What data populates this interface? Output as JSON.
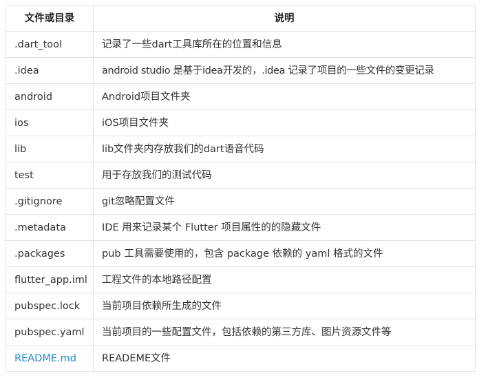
{
  "table": {
    "headers": [
      "文件或目录",
      "说明"
    ],
    "rows": [
      {
        "name": ".dart_tool",
        "desc": "记录了一些dart工具库所在的位置和信息"
      },
      {
        "name": ".idea",
        "desc": "android studio 是基于idea开发的，.idea 记录了项目的一些文件的变更记录"
      },
      {
        "name": "android",
        "desc": "Android项目文件夹"
      },
      {
        "name": "ios",
        "desc": "iOS项目文件夹"
      },
      {
        "name": "lib",
        "desc": "lib文件夹内存放我们的dart语音代码"
      },
      {
        "name": "test",
        "desc": "用于存放我们的测试代码"
      },
      {
        "name": ".gitignore",
        "desc": "git忽略配置文件"
      },
      {
        "name": ".metadata",
        "desc": "IDE 用来记录某个 Flutter 项目属性的的隐藏文件"
      },
      {
        "name": ".packages",
        "desc": "pub 工具需要使用的，包含 package 依赖的 yaml 格式的文件"
      },
      {
        "name": "flutter_app.iml",
        "desc": "工程文件的本地路径配置"
      },
      {
        "name": "pubspec.lock",
        "desc": "当前项目依赖所生成的文件"
      },
      {
        "name": "pubspec.yaml",
        "desc": "当前项目的一些配置文件，包括依赖的第三方库、图片资源文件等"
      },
      {
        "name": "README.md",
        "desc": "READEME文件"
      }
    ]
  },
  "colors": {
    "link": "#1e88c8",
    "border": "#dfe2e5",
    "text": "#333333"
  }
}
